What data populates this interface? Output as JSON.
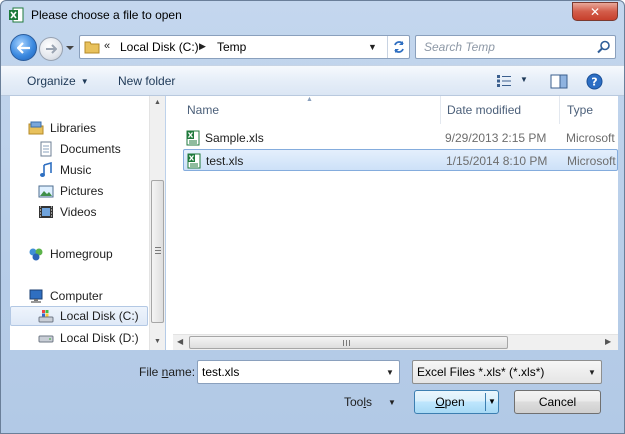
{
  "window": {
    "title": "Please choose a file to open",
    "close_label": "✕"
  },
  "address_bar": {
    "overflow": "«",
    "crumbs": [
      "Local Disk (C:)",
      "Temp"
    ]
  },
  "search": {
    "placeholder": "Search Temp"
  },
  "toolbar": {
    "organize_label": "Organize",
    "new_folder_label": "New folder"
  },
  "nav": {
    "libraries": "Libraries",
    "documents": "Documents",
    "music": "Music",
    "pictures": "Pictures",
    "videos": "Videos",
    "homegroup": "Homegroup",
    "computer": "Computer",
    "local_c": "Local Disk (C:)",
    "local_d": "Local Disk (D:)"
  },
  "columns": {
    "name": "Name",
    "date": "Date modified",
    "type": "Type"
  },
  "files": [
    {
      "name": "Sample.xls",
      "date": "9/29/2013 2:15 PM",
      "type": "Microsoft"
    },
    {
      "name": "test.xls",
      "date": "1/15/2014 8:10 PM",
      "type": "Microsoft"
    }
  ],
  "file_name": {
    "label_pre": "File ",
    "label_u": "n",
    "label_post": "ame:",
    "value": "test.xls"
  },
  "file_type": {
    "value": "Excel Files *.xls* (*.xls*)"
  },
  "buttons": {
    "tools_pre": "Too",
    "tools_u": "l",
    "tools_post": "s",
    "open_u": "O",
    "open_post": "pen",
    "cancel": "Cancel"
  },
  "colors": {
    "accent": "#3c8ae0",
    "selection": "#cde1f8",
    "excel_green": "#1f7a3c",
    "close_red": "#c7402c"
  }
}
